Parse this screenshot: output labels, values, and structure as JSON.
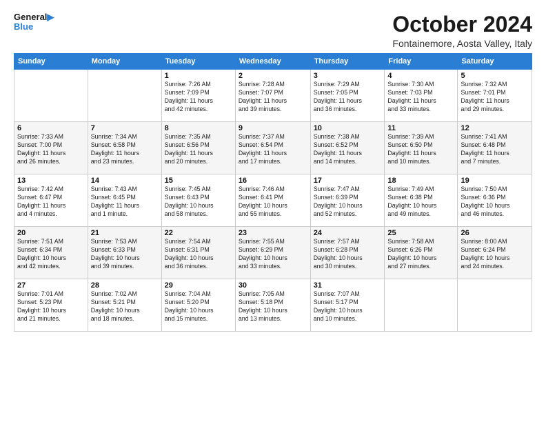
{
  "header": {
    "logo_line1": "General",
    "logo_line2": "Blue",
    "month": "October 2024",
    "location": "Fontainemore, Aosta Valley, Italy"
  },
  "weekdays": [
    "Sunday",
    "Monday",
    "Tuesday",
    "Wednesday",
    "Thursday",
    "Friday",
    "Saturday"
  ],
  "weeks": [
    [
      {
        "day": "",
        "text": ""
      },
      {
        "day": "",
        "text": ""
      },
      {
        "day": "1",
        "text": "Sunrise: 7:26 AM\nSunset: 7:09 PM\nDaylight: 11 hours\nand 42 minutes."
      },
      {
        "day": "2",
        "text": "Sunrise: 7:28 AM\nSunset: 7:07 PM\nDaylight: 11 hours\nand 39 minutes."
      },
      {
        "day": "3",
        "text": "Sunrise: 7:29 AM\nSunset: 7:05 PM\nDaylight: 11 hours\nand 36 minutes."
      },
      {
        "day": "4",
        "text": "Sunrise: 7:30 AM\nSunset: 7:03 PM\nDaylight: 11 hours\nand 33 minutes."
      },
      {
        "day": "5",
        "text": "Sunrise: 7:32 AM\nSunset: 7:01 PM\nDaylight: 11 hours\nand 29 minutes."
      }
    ],
    [
      {
        "day": "6",
        "text": "Sunrise: 7:33 AM\nSunset: 7:00 PM\nDaylight: 11 hours\nand 26 minutes."
      },
      {
        "day": "7",
        "text": "Sunrise: 7:34 AM\nSunset: 6:58 PM\nDaylight: 11 hours\nand 23 minutes."
      },
      {
        "day": "8",
        "text": "Sunrise: 7:35 AM\nSunset: 6:56 PM\nDaylight: 11 hours\nand 20 minutes."
      },
      {
        "day": "9",
        "text": "Sunrise: 7:37 AM\nSunset: 6:54 PM\nDaylight: 11 hours\nand 17 minutes."
      },
      {
        "day": "10",
        "text": "Sunrise: 7:38 AM\nSunset: 6:52 PM\nDaylight: 11 hours\nand 14 minutes."
      },
      {
        "day": "11",
        "text": "Sunrise: 7:39 AM\nSunset: 6:50 PM\nDaylight: 11 hours\nand 10 minutes."
      },
      {
        "day": "12",
        "text": "Sunrise: 7:41 AM\nSunset: 6:48 PM\nDaylight: 11 hours\nand 7 minutes."
      }
    ],
    [
      {
        "day": "13",
        "text": "Sunrise: 7:42 AM\nSunset: 6:47 PM\nDaylight: 11 hours\nand 4 minutes."
      },
      {
        "day": "14",
        "text": "Sunrise: 7:43 AM\nSunset: 6:45 PM\nDaylight: 11 hours\nand 1 minute."
      },
      {
        "day": "15",
        "text": "Sunrise: 7:45 AM\nSunset: 6:43 PM\nDaylight: 10 hours\nand 58 minutes."
      },
      {
        "day": "16",
        "text": "Sunrise: 7:46 AM\nSunset: 6:41 PM\nDaylight: 10 hours\nand 55 minutes."
      },
      {
        "day": "17",
        "text": "Sunrise: 7:47 AM\nSunset: 6:39 PM\nDaylight: 10 hours\nand 52 minutes."
      },
      {
        "day": "18",
        "text": "Sunrise: 7:49 AM\nSunset: 6:38 PM\nDaylight: 10 hours\nand 49 minutes."
      },
      {
        "day": "19",
        "text": "Sunrise: 7:50 AM\nSunset: 6:36 PM\nDaylight: 10 hours\nand 46 minutes."
      }
    ],
    [
      {
        "day": "20",
        "text": "Sunrise: 7:51 AM\nSunset: 6:34 PM\nDaylight: 10 hours\nand 42 minutes."
      },
      {
        "day": "21",
        "text": "Sunrise: 7:53 AM\nSunset: 6:33 PM\nDaylight: 10 hours\nand 39 minutes."
      },
      {
        "day": "22",
        "text": "Sunrise: 7:54 AM\nSunset: 6:31 PM\nDaylight: 10 hours\nand 36 minutes."
      },
      {
        "day": "23",
        "text": "Sunrise: 7:55 AM\nSunset: 6:29 PM\nDaylight: 10 hours\nand 33 minutes."
      },
      {
        "day": "24",
        "text": "Sunrise: 7:57 AM\nSunset: 6:28 PM\nDaylight: 10 hours\nand 30 minutes."
      },
      {
        "day": "25",
        "text": "Sunrise: 7:58 AM\nSunset: 6:26 PM\nDaylight: 10 hours\nand 27 minutes."
      },
      {
        "day": "26",
        "text": "Sunrise: 8:00 AM\nSunset: 6:24 PM\nDaylight: 10 hours\nand 24 minutes."
      }
    ],
    [
      {
        "day": "27",
        "text": "Sunrise: 7:01 AM\nSunset: 5:23 PM\nDaylight: 10 hours\nand 21 minutes."
      },
      {
        "day": "28",
        "text": "Sunrise: 7:02 AM\nSunset: 5:21 PM\nDaylight: 10 hours\nand 18 minutes."
      },
      {
        "day": "29",
        "text": "Sunrise: 7:04 AM\nSunset: 5:20 PM\nDaylight: 10 hours\nand 15 minutes."
      },
      {
        "day": "30",
        "text": "Sunrise: 7:05 AM\nSunset: 5:18 PM\nDaylight: 10 hours\nand 13 minutes."
      },
      {
        "day": "31",
        "text": "Sunrise: 7:07 AM\nSunset: 5:17 PM\nDaylight: 10 hours\nand 10 minutes."
      },
      {
        "day": "",
        "text": ""
      },
      {
        "day": "",
        "text": ""
      }
    ]
  ]
}
